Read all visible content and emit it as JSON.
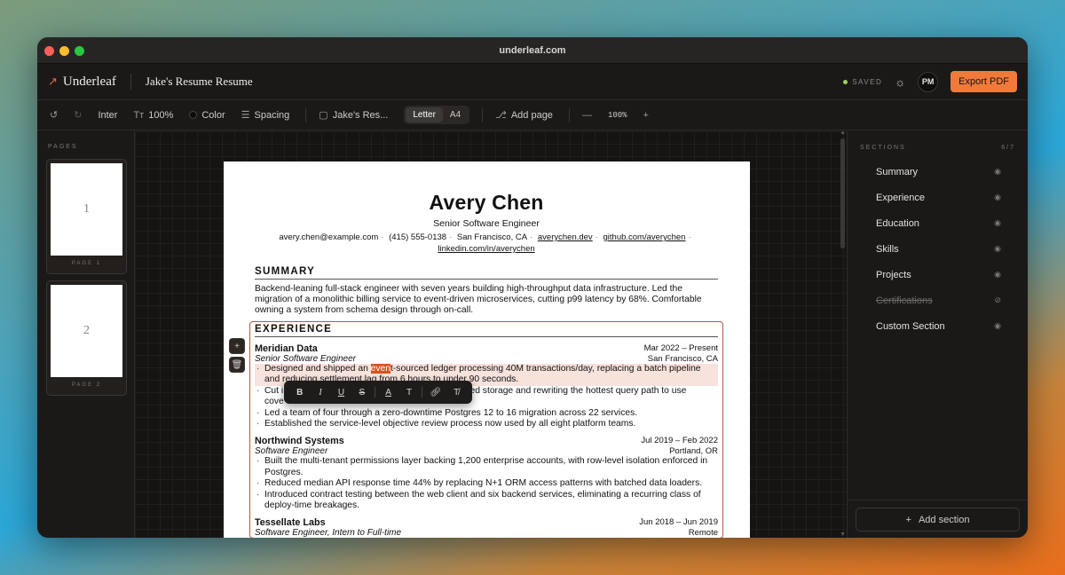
{
  "browser": {
    "url": "underleaf.com"
  },
  "app": {
    "name": "Underleaf",
    "doc_title": "Jake's Resume Resume",
    "status": "SAVED",
    "avatar_initials": "PM",
    "export_label": "Export PDF",
    "accent_color": "#f07a3a"
  },
  "toolbar": {
    "font": "Inter",
    "font_size": "100%",
    "color_label": "Color",
    "spacing_label": "Spacing",
    "template": "Jake's Res...",
    "paper_sizes": [
      "Letter",
      "A4"
    ],
    "paper_selected": "Letter",
    "add_page": "Add page",
    "zoom": "100%"
  },
  "pages": {
    "label": "PAGES",
    "items": [
      {
        "num": "1",
        "label": "PAGE 1"
      },
      {
        "num": "2",
        "label": "PAGE 2"
      }
    ]
  },
  "resume": {
    "name": "Avery Chen",
    "role": "Senior Software Engineer",
    "contacts": {
      "email": "avery.chen@example.com",
      "phone": "(415) 555-0138",
      "location": "San Francisco, CA",
      "site": "averychen.dev",
      "github": "github.com/averychen",
      "linkedin": "linkedin.com/in/averychen"
    },
    "summary_title": "SUMMARY",
    "summary": "Backend-leaning full-stack engineer with seven years building high-throughput data infrastructure. Led the migration of a monolithic billing service to event-driven microservices, cutting p99 latency by 68%. Comfortable owning a system from schema design through on-call.",
    "experience_title": "EXPERIENCE",
    "jobs": [
      {
        "company": "Meridian Data",
        "dates": "Mar 2022 – Present",
        "title": "Senior Software Engineer",
        "location": "San Francisco, CA",
        "b1_pre": "Designed and shipped an ",
        "b1_hl": "even",
        "b1_post": "t-sourced ledger processing 40M transactions/day, replacing a batch pipeline and reducing settlement lag from 6 hours to under 90 seconds.",
        "b2": "Cut i... tiered storage and rewriting the hottest query path to use cove...",
        "b2_start": "Cut i",
        "b2_end": "tiered storage and rewriting the hottest query path to use",
        "b2_cont": "cove",
        "b3": "Led a team of four through a zero-downtime Postgres 12 to 16 migration across 22 services.",
        "b4": "Established the service-level objective review process now used by all eight platform teams."
      },
      {
        "company": "Northwind Systems",
        "dates": "Jul 2019 – Feb 2022",
        "title": "Software Engineer",
        "location": "Portland, OR",
        "b1": "Built the multi-tenant permissions layer backing 1,200 enterprise accounts, with row-level isolation enforced in Postgres.",
        "b2": "Reduced median API response time 44% by replacing N+1 ORM access patterns with batched data loaders.",
        "b3": "Introduced contract testing between the web client and six backend services, eliminating a recurring class of deploy-time breakages."
      },
      {
        "company": "Tessellate Labs",
        "dates": "Jun 2018 – Jun 2019",
        "title": "Software Engineer, Intern to Full-time",
        "location": "Remote"
      }
    ]
  },
  "format_toolbar": [
    "B",
    "I",
    "U",
    "S",
    "A",
    "T",
    "link",
    "clear"
  ],
  "sections": {
    "label": "SECTIONS",
    "count": "6/7",
    "items": [
      {
        "label": "Summary",
        "visible": true
      },
      {
        "label": "Experience",
        "visible": true
      },
      {
        "label": "Education",
        "visible": true
      },
      {
        "label": "Skills",
        "visible": true
      },
      {
        "label": "Projects",
        "visible": true
      },
      {
        "label": "Certifications",
        "visible": false
      },
      {
        "label": "Custom Section",
        "visible": true
      }
    ],
    "add_label": "Add section"
  }
}
